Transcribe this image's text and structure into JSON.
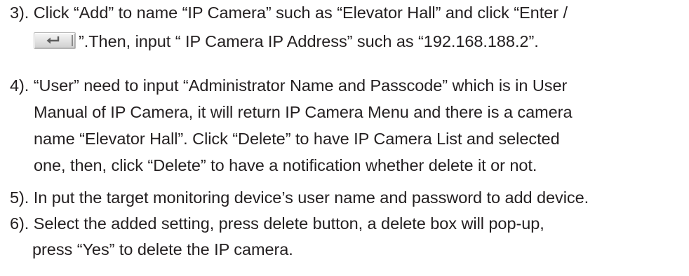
{
  "document": {
    "lines": [
      "3). Click “Add” to name “IP Camera” such as “Elevator Hall” and click “Enter /",
      "”.Then, input “ IP Camera IP Address” such as “192.168.188.2”.",
      "4). “User” need to input “Administrator Name and Passcode” which is in User",
      "Manual of IP Camera,  it will return IP Camera Menu and there is a camera",
      "name “Elevator Hall”. Click “Delete” to have IP Camera List and selected",
      "one,  then, click “Delete” to have a notification whether delete it or not.",
      "5). In put the target monitoring device’s user name and password to add device.",
      "6). Select the added setting, press delete button, a delete box will pop-up,",
      "press “Yes” to delete the IP camera."
    ],
    "icons": {
      "enter_key": "enter-key-icon"
    }
  }
}
